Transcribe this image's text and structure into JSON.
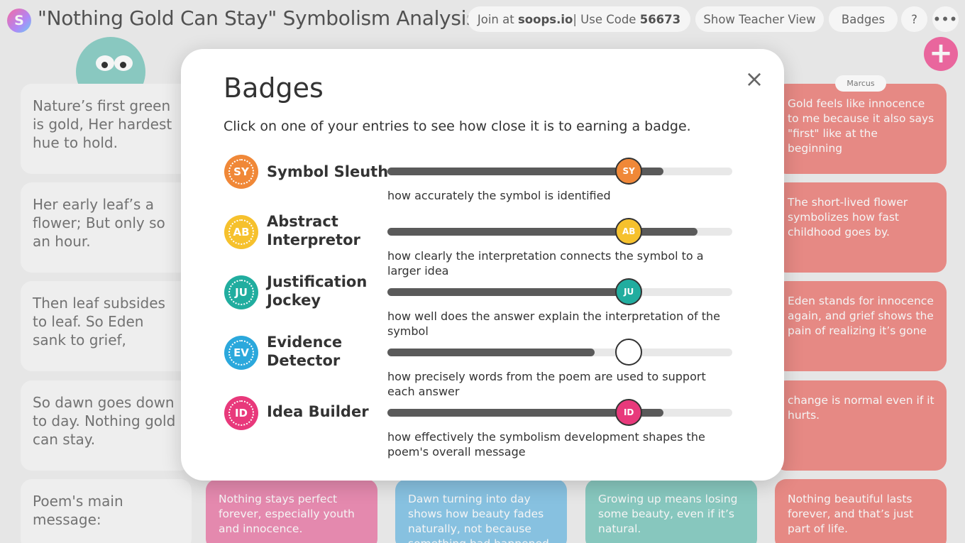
{
  "header": {
    "logo_letter": "S",
    "title": "\"Nothing Gold Can Stay\" Symbolism Analysis",
    "join_prefix": "Join at ",
    "join_site": "soops.io",
    "join_mid": " | Use Code ",
    "join_code": "56673",
    "teacher_view": "Show Teacher View",
    "badges": "Badges",
    "help": "?",
    "more": "•••",
    "add": "+"
  },
  "poem_lines": [
    "Nature’s first green is gold, Her hardest hue to hold.",
    "Her early leaf’s a flower; But only so an hour.",
    "Then leaf subsides to leaf. So Eden sank to grief,",
    "So dawn goes down to day. Nothing gold can stay.",
    "Poem's main message:"
  ],
  "right_name": "Marcus",
  "right_responses": [
    "Gold feels like innocence to me because it also says \"first\" like at the beginning",
    "The short-lived flower symbolizes how fast childhood goes by.",
    "Eden stands for innocence again, and grief shows the pain of realizing it’s gone",
    "change is normal even if it hurts."
  ],
  "bottom_responses": [
    {
      "text": "Nothing stays perfect forever, especially youth and innocence.",
      "color": "#ee8fb6"
    },
    {
      "text": "Dawn turning into day shows how beauty fades naturally, not because something bad happened",
      "color": "#8dc9ea"
    },
    {
      "text": "Growing up means losing some beauty, even if it’s natural.",
      "color": "#8dd0c6"
    },
    {
      "text": "Nothing beautiful lasts forever, and that’s just part of life.",
      "color": "#f08f8a"
    }
  ],
  "modal": {
    "title": "Badges",
    "close": "×",
    "instructions": "Click on one of your entries to see how close it is to earning a badge.",
    "badges": [
      {
        "abbr": "SY",
        "name": "Symbol Sleuth",
        "desc": "how accurately the symbol is identified",
        "color": "#f08838",
        "progress": 0.8,
        "knob": 0.7,
        "knob_filled": true
      },
      {
        "abbr": "AB",
        "name": "Abstract Interpretor",
        "desc": "how clearly the interpretation connects the symbol to a larger idea",
        "color": "#f6c12d",
        "progress": 0.9,
        "knob": 0.7,
        "knob_filled": true
      },
      {
        "abbr": "JU",
        "name": "Justification Jockey",
        "desc": "how well does the answer explain the interpretation of the symbol",
        "color": "#21ad9f",
        "progress": 0.72,
        "knob": 0.7,
        "knob_filled": true
      },
      {
        "abbr": "EV",
        "name": "Evidence Detector",
        "desc": "how precisely words from the poem are used to support each answer",
        "color": "#2ba8dc",
        "progress": 0.6,
        "knob": 0.7,
        "knob_filled": false
      },
      {
        "abbr": "ID",
        "name": "Idea Builder",
        "desc": "how effectively the symbolism development shapes the poem's overall message",
        "color": "#e8397b",
        "progress": 0.8,
        "knob": 0.7,
        "knob_filled": true
      }
    ]
  }
}
